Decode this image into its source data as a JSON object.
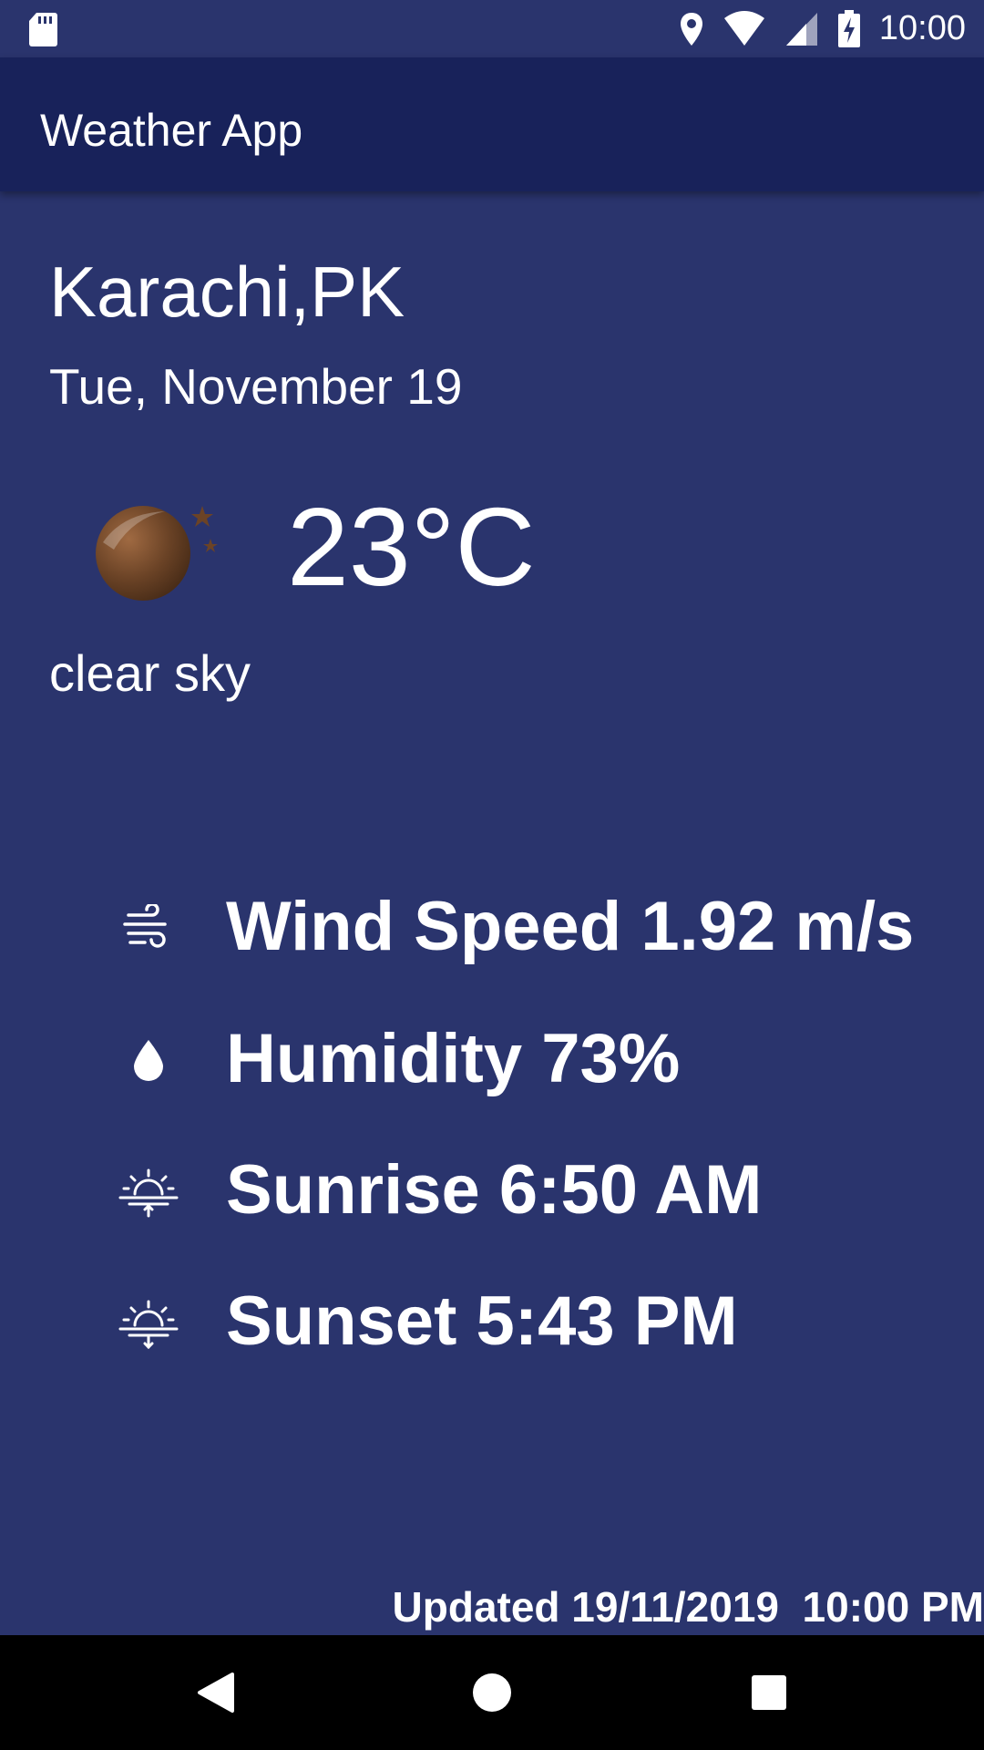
{
  "status_bar": {
    "time": "10:00",
    "icons": [
      "sd-card-icon",
      "location-icon",
      "wifi-icon",
      "signal-icon",
      "battery-charging-icon"
    ]
  },
  "app_bar": {
    "title": "Weather App"
  },
  "current": {
    "city": "Karachi,PK",
    "date": "Tue, November 19",
    "temperature": "23°C",
    "description": "clear sky",
    "icon": "moon-clear-night-icon"
  },
  "stats": [
    {
      "icon": "wind-icon",
      "text": "Wind Speed 1.92 m/s"
    },
    {
      "icon": "humidity-drop-icon",
      "text": "Humidity 73%"
    },
    {
      "icon": "sunrise-icon",
      "text": "Sunrise 6:50 AM"
    },
    {
      "icon": "sunset-icon",
      "text": "Sunset 5:43 PM"
    }
  ],
  "footer": {
    "updated": "Updated 19/11/2019  10:00 PM"
  },
  "nav": {
    "icons": [
      "back-icon",
      "home-icon",
      "recents-icon"
    ]
  },
  "colors": {
    "background": "#2a346d",
    "app_bar": "#18225a",
    "text": "#ffffff",
    "moon": "#6b4326"
  }
}
